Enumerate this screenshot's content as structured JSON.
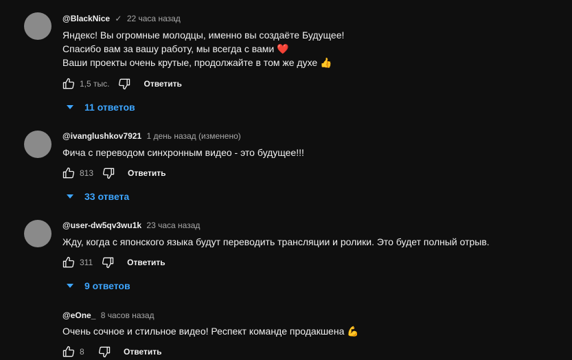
{
  "comments": [
    {
      "author": "@BlackNice",
      "verified_icon": "checkmark-icon",
      "time": "22 часа назад",
      "lines": [
        "Яндекс! Вы огромные молодцы, именно вы создаёте Будущее!",
        "Спасибо вам за вашу работу, мы всегда с вами ❤️",
        "Ваши проекты очень крутые, продолжайте в том же духе 👍"
      ],
      "likes": "1,5 тыс.",
      "reply_label": "Ответить",
      "replies_label": "11 ответов"
    },
    {
      "author": "@ivanglushkov7921",
      "time": "1 день назад (изменено)",
      "lines": [
        "Фича с переводом синхронным видео - это будущее!!!"
      ],
      "likes": "813",
      "reply_label": "Ответить",
      "replies_label": "33 ответа"
    },
    {
      "author": "@user-dw5qv3wu1k",
      "time": "23 часа назад",
      "lines": [
        "Жду, когда с японского языка будут переводить трансляции и ролики. Это будет полный отрыв."
      ],
      "likes": "311",
      "reply_label": "Ответить",
      "replies_label": "9 ответов"
    },
    {
      "author": "@eOne_",
      "time": "8 часов назад",
      "lines": [
        "Очень сочное и стильное видео! Респект команде продакшена 💪"
      ],
      "likes": "8",
      "reply_label": "Ответить"
    }
  ],
  "colors": {
    "background": "#0f0f0f",
    "text": "#f1f1f1",
    "secondary_text": "#aaaaaa",
    "link_blue": "#3ea6ff",
    "avatar_gray": "#8a8a8a"
  },
  "icons": {
    "like": "thumbs-up-icon",
    "dislike": "thumbs-down-icon",
    "expand": "triangle-down-icon"
  }
}
